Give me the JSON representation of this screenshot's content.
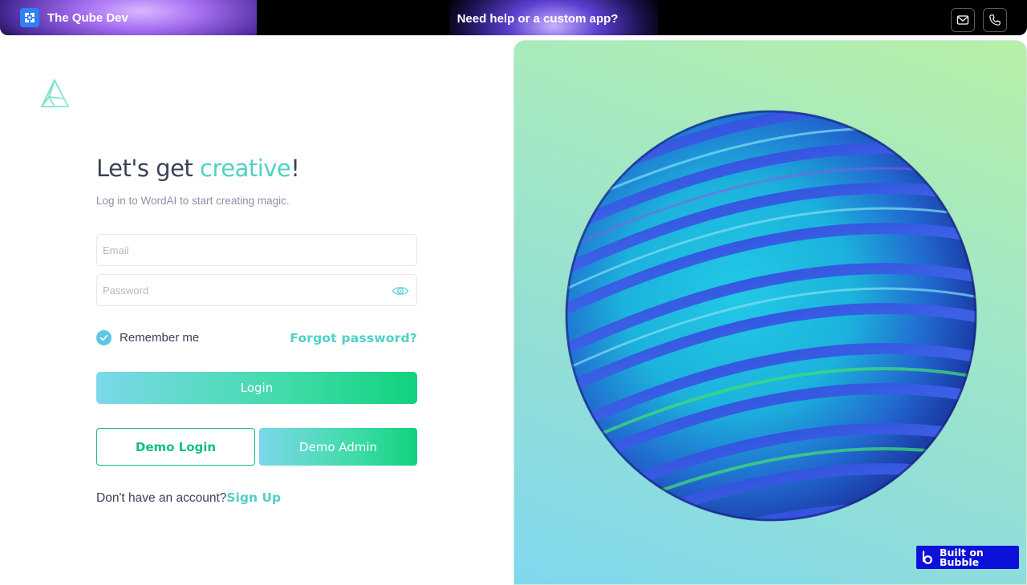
{
  "banner": {
    "brand_name": "The Qube Dev",
    "headline": "Need help or a custom app?",
    "email_icon": "mail-icon",
    "phone_icon": "phone-icon"
  },
  "login": {
    "heading_prefix": "Let's get ",
    "heading_accent": "creative",
    "heading_suffix": "!",
    "subtitle": "Log in to WordAI to start creating magic.",
    "email_placeholder": "Email",
    "password_placeholder": "Password",
    "remember_label": "Remember me",
    "forgot_label": "Forgot password?",
    "login_label": "Login",
    "demo_login_label": "Demo Login",
    "demo_admin_label": "Demo Admin",
    "no_account_text": "Don't have an account?",
    "signup_label": "Sign Up",
    "remember_checked": true
  },
  "badge": {
    "label": "Built on Bubble"
  },
  "colors": {
    "accent": "#4fd1c5",
    "green": "#10d27d",
    "text": "#3b4257",
    "badge": "#0d10d8"
  }
}
